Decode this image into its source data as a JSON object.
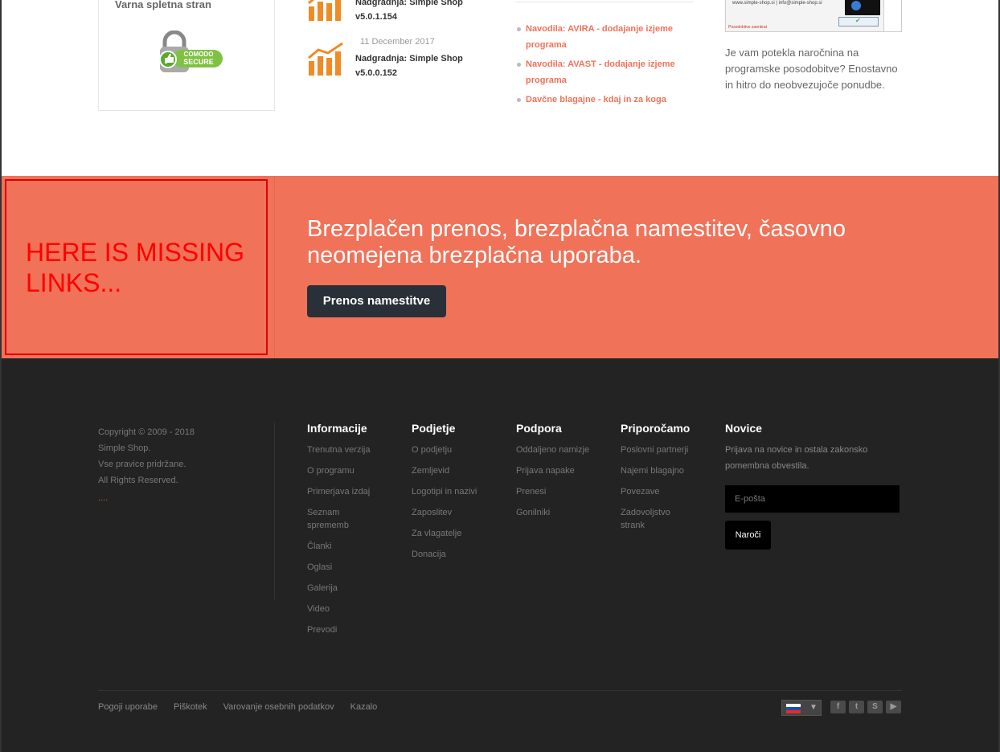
{
  "top": {
    "secure_title": "Varna spletna stran",
    "comodo": {
      "line1": "COMODO",
      "line2": "SECURE"
    },
    "news": [
      {
        "date": "",
        "title_line1": "Nadgradnja: Simple Shop",
        "title_line2": "v5.0.1.154"
      },
      {
        "date": "11 December 2017",
        "title_line1": "Nadgradnja: Simple Shop",
        "title_line2": "v5.0.0.152"
      }
    ],
    "links": [
      "Navodila: AVIRA - dodajanje izjeme programa",
      "Navodila: AVAST - dodajanje izjeme programa",
      "Davčne blagajne - kdaj in za koga"
    ],
    "promo": {
      "image_text": "www.simple-shop.si | info@simple-shop.si",
      "image_footer": "Posodobitve zaenkrat",
      "text": "Je vam potekla naročnina na programske posodobitve? Enostavno in hitro do neobvezujoče ponudbe."
    }
  },
  "banner": {
    "missing_note": "HERE IS MISSING LINKS...",
    "heading": "Brezplačen prenos, brezplačna namestitev, časovno neomejena brezplačna uporaba.",
    "button": "Prenos namestitve",
    "accent": "#f07259",
    "button_color": "#2a3038"
  },
  "footer": {
    "copyright": [
      "Copyright © 2009 - 2018",
      "Simple Shop.",
      "Vse pravice pridržane.",
      "All Rights Reserved."
    ],
    "dots": "....",
    "columns": [
      {
        "title": "Informacije",
        "items": [
          "Trenutna verzija",
          "O programu",
          "Primerjava izdaj",
          "Seznam sprememb",
          "Članki",
          "Oglasi",
          "Galerija",
          "Video",
          "Prevodi"
        ]
      },
      {
        "title": "Podjetje",
        "items": [
          "O podjetju",
          "Zemljevid",
          "Logotipi in nazivi",
          "Zaposlitev",
          "Za vlagatelje",
          "Donacija"
        ]
      },
      {
        "title": "Podpora",
        "items": [
          "Oddaljeno namizje",
          "Prijava napake",
          "Prenesi",
          "Gonilniki"
        ]
      },
      {
        "title": "Priporočamo",
        "items": [
          "Poslovni partnerji",
          "Najemi blagajno",
          "Povezave",
          "Zadovoljstvo strank"
        ]
      }
    ],
    "newsletter": {
      "title": "Novice",
      "text": "Prijava na novice in ostala zakonsko pomembna obvestila.",
      "placeholder": "E-pošta",
      "button": "Naroči"
    },
    "bottom_links": [
      "Pogoji uporabe",
      "Piškotek",
      "Varovanje osebnih podatkov",
      "Kazalo"
    ],
    "language_icon": "slovenia-flag-icon",
    "social": [
      {
        "icon": "facebook-icon",
        "glyph": "f"
      },
      {
        "icon": "twitter-icon",
        "glyph": "t"
      },
      {
        "icon": "skype-icon",
        "glyph": "S"
      },
      {
        "icon": "youtube-icon",
        "glyph": "▶"
      }
    ]
  }
}
